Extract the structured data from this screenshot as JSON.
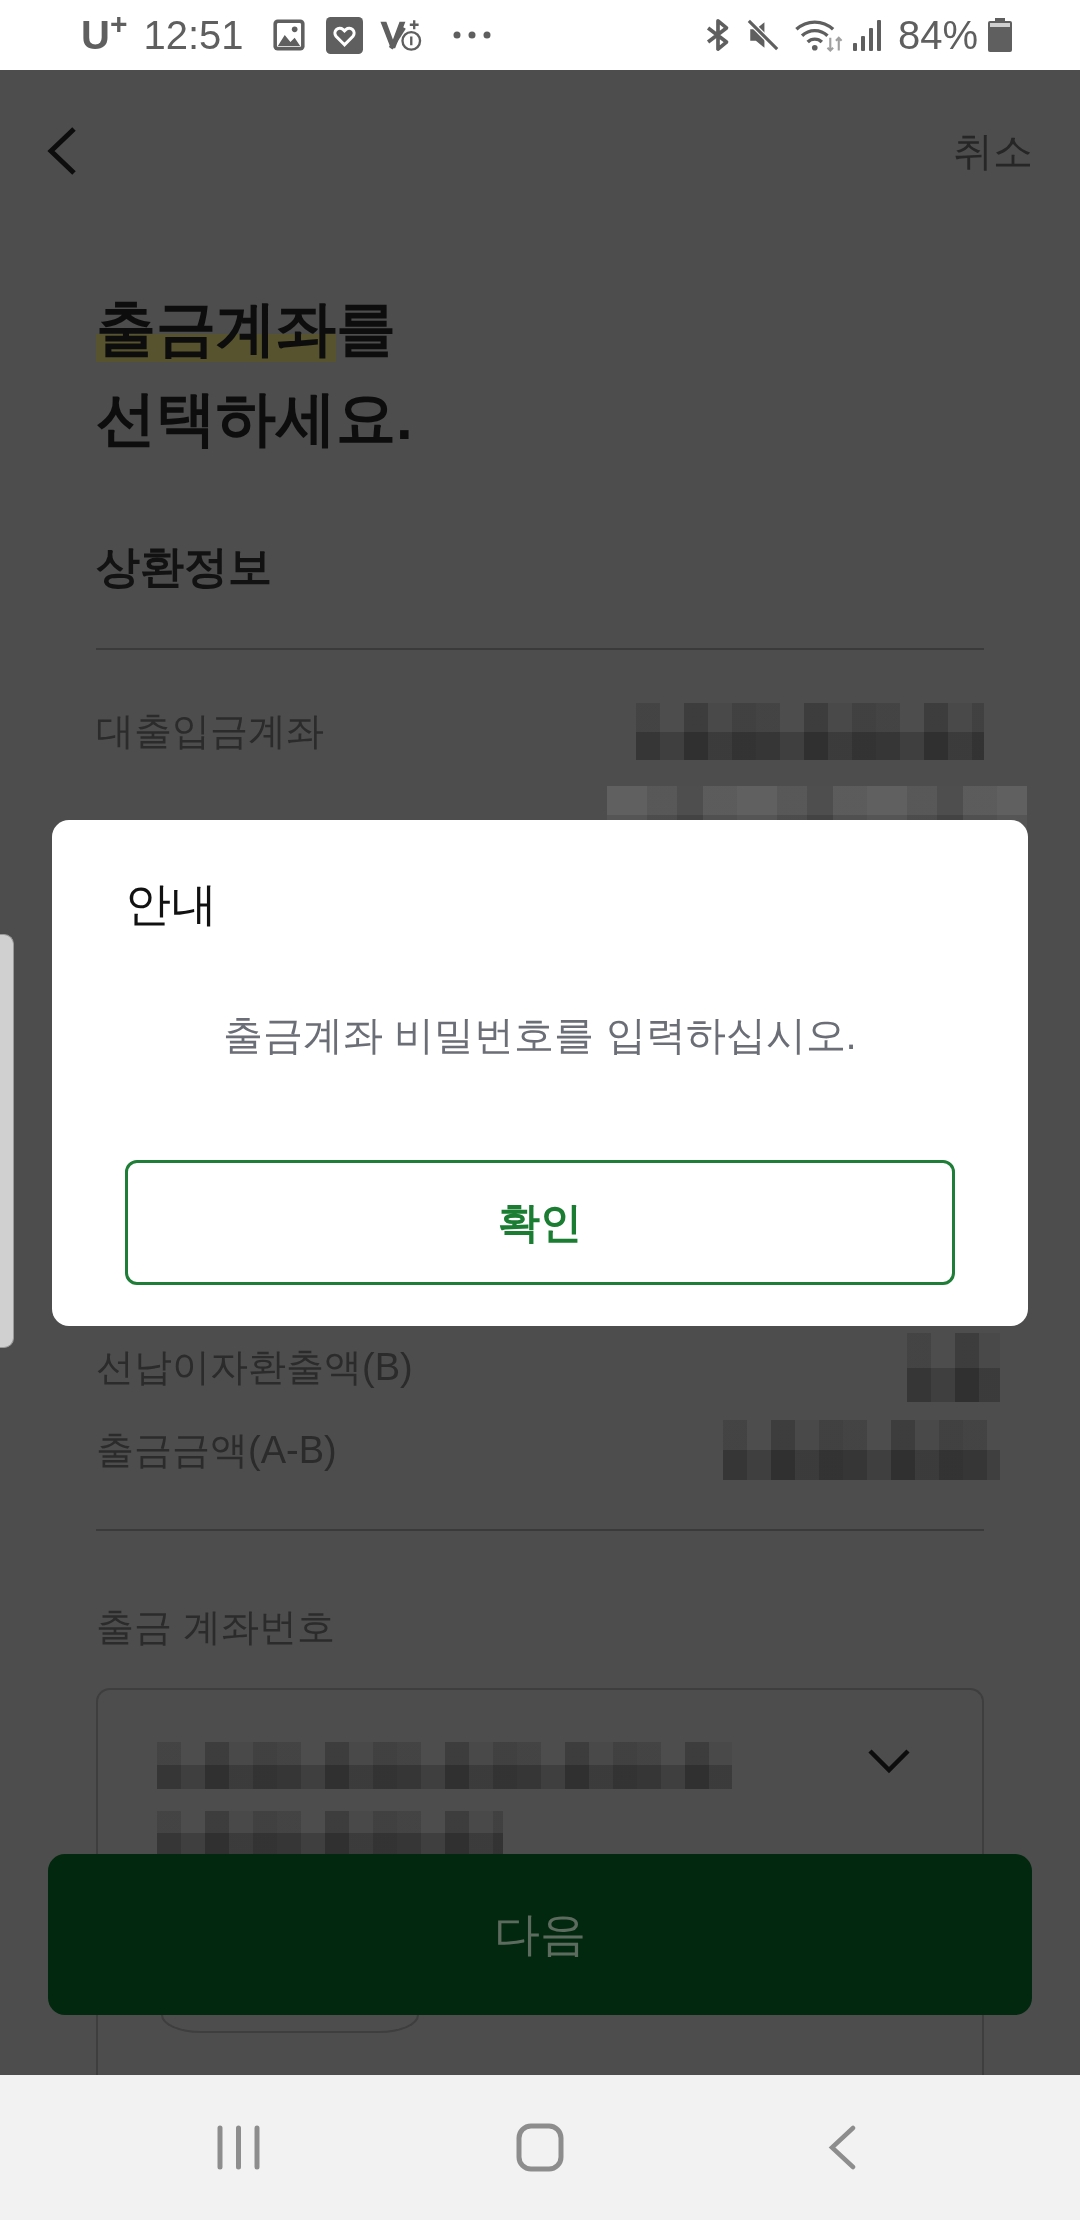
{
  "status_bar": {
    "carrier": "U$^{+}$",
    "time": "12:51",
    "battery": "84%"
  },
  "header": {
    "cancel": "취소"
  },
  "title": {
    "lines": [
      [
        {
          "text": "출금계좌",
          "highlight": true
        },
        {
          "text": "를",
          "highlight": false
        }
      ],
      [
        {
          "text": "선택하세요.",
          "highlight": false
        }
      ]
    ]
  },
  "repayment_info": {
    "title": "상환정보",
    "rows_above_dialog": [
      {
        "label": "대출입금계좌",
        "value_redacted": true
      },
      {
        "value_redacted": true
      }
    ],
    "rows_below_dialog": [
      {
        "label": "선납이자환출액(B)",
        "value_redacted": true
      },
      {
        "label": "출금금액(A-B)",
        "value_redacted": true
      }
    ]
  },
  "account_field": {
    "label": "출금 계좌번호",
    "value_redacted": true,
    "expanded": false
  },
  "next_button": {
    "label": "다음"
  },
  "dialog": {
    "title": "안내",
    "message": "출금계좌 비밀번호를 입력하십시오.",
    "button": "확인"
  }
}
